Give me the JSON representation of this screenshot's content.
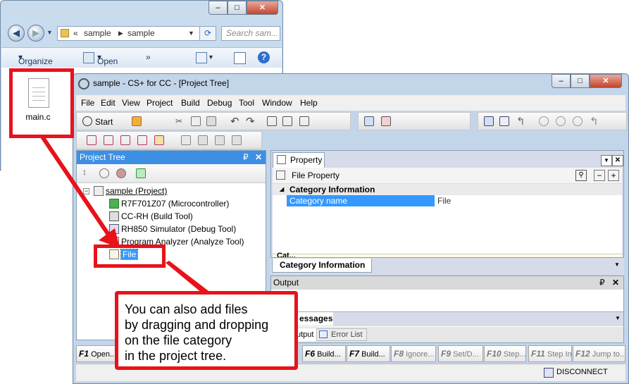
{
  "explorer": {
    "address": {
      "prefix": "«",
      "crumbs": [
        "sample",
        "sample"
      ]
    },
    "search_placeholder": "Search sam...",
    "toolbar": {
      "organize": "Organize",
      "open": "Open",
      "more": "»"
    },
    "file": {
      "name": "main.c"
    }
  },
  "csplus": {
    "title": "sample - CS+ for CC - [Project Tree]",
    "menu": [
      "File",
      "Edit",
      "View",
      "Project",
      "Build",
      "Debug",
      "Tool",
      "Window",
      "Help"
    ],
    "start_label": "Start",
    "project_tree": {
      "title": "Project Tree",
      "pin": "₽",
      "close": "✕",
      "root": "sample (Project)",
      "items": [
        "R7F701Z07 (Microcontroller)",
        "CC-RH (Build Tool)",
        "RH850 Simulator (Debug Tool)",
        "Program Analyzer (Analyze Tool)"
      ],
      "file_category": "File"
    },
    "property": {
      "tab": "Property",
      "header": "File Property",
      "category": "Category Information",
      "row_name": "Category name",
      "row_value": "File",
      "bottom_tab": "Category Information",
      "cut_label": "Cat..."
    },
    "output": {
      "title": "Output",
      "messages_tab": "essages",
      "tabs": [
        "utput",
        "Error List"
      ]
    },
    "fkeys": [
      {
        "key": "F1",
        "label": "Open..."
      },
      {
        "key": "F6",
        "label": "Build..."
      },
      {
        "key": "F7",
        "label": "Build..."
      },
      {
        "key": "F8",
        "label": "Ignore..."
      },
      {
        "key": "F9",
        "label": "Set/D..."
      },
      {
        "key": "F10",
        "label": "Step..."
      },
      {
        "key": "F11",
        "label": "Step In"
      },
      {
        "key": "F12",
        "label": "Jump to..."
      }
    ],
    "status": "DISCONNECT"
  },
  "callout": {
    "lines": [
      "You can also add files",
      "by dragging and dropping",
      "on the file category",
      "in the project tree."
    ]
  },
  "colors": {
    "highlight_red": "#e8121b",
    "selection_blue": "#3399ff"
  }
}
